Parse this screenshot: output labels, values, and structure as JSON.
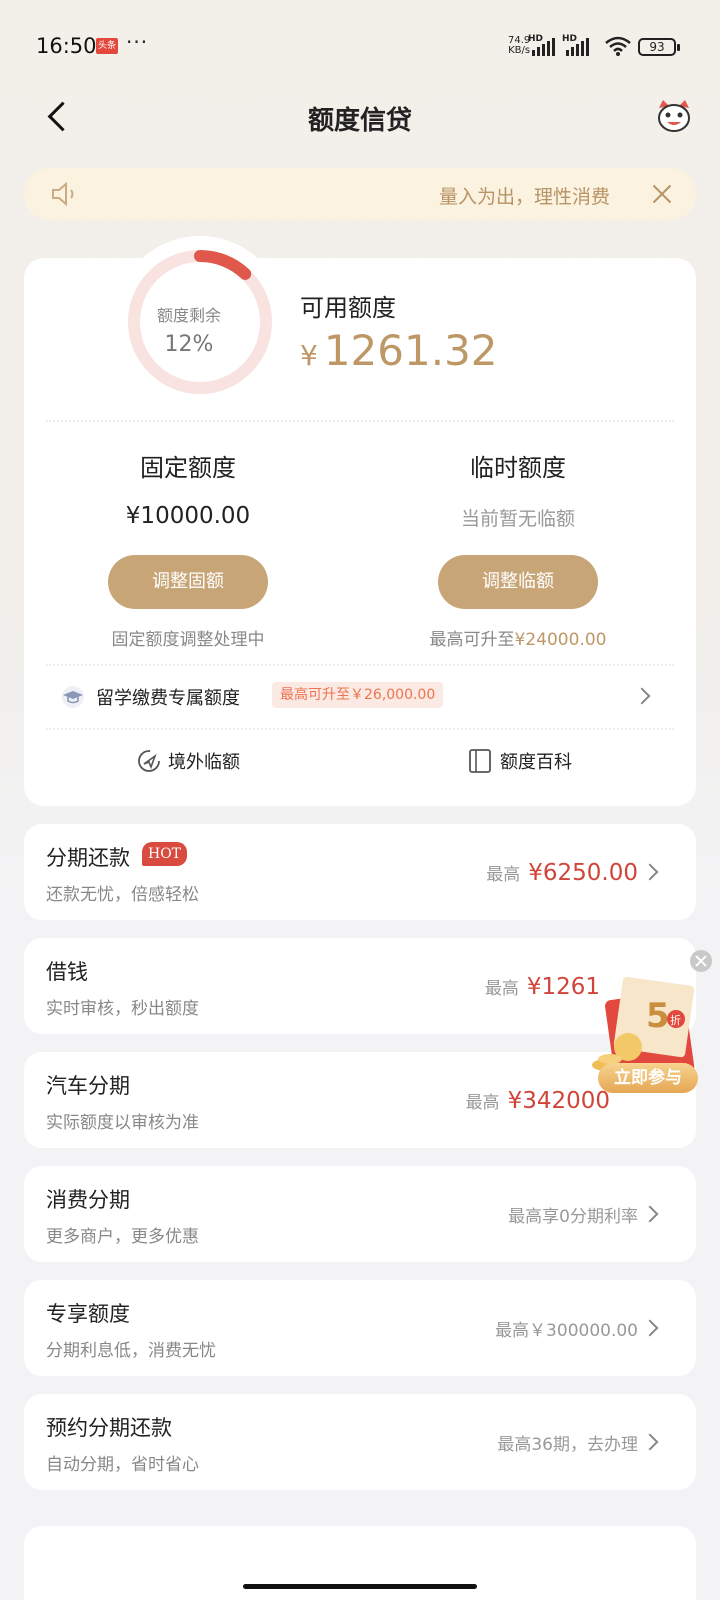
{
  "status_bar": {
    "time": "16:50",
    "news_badge": "头条",
    "more": "···",
    "net_speed": "74.9",
    "net_unit": "KB/s",
    "hd1": "HD",
    "hd2": "HD",
    "battery": "93"
  },
  "nav": {
    "title": "额度信贷",
    "back_icon": "chevron-left-icon",
    "mascot_icon": "mascot-icon"
  },
  "notice": {
    "text": "量入为出，理性消费",
    "icon": "speaker-icon"
  },
  "quota": {
    "ring_label": "额度剩余",
    "ring_percent": "12%",
    "ring_fraction": 0.12,
    "available_label": "可用额度",
    "available_currency": "¥",
    "available_amount": "1261.32",
    "fixed": {
      "title": "固定额度",
      "amount": "¥10000.00",
      "button": "调整固额",
      "note": "固定额度调整处理中"
    },
    "temporary": {
      "title": "临时额度",
      "status": "当前暂无临额",
      "button": "调整临额",
      "note_prefix": "最高可升至",
      "note_value": "¥24000.00"
    },
    "study": {
      "label": "留学缴费专属额度",
      "tag": "最高可升至￥26,000.00"
    },
    "links": {
      "overseas": "境外临额",
      "encyclopedia": "额度百科"
    }
  },
  "services": [
    {
      "title": "分期还款",
      "badge": "HOT",
      "subtitle": "还款无忧，倍感轻松",
      "prefix": "最高",
      "value": "¥6250.00"
    },
    {
      "title": "借钱",
      "subtitle": "实时审核，秒出额度",
      "prefix": "最高",
      "value": "¥1261"
    },
    {
      "title": "汽车分期",
      "subtitle": "实际额度以审核为准",
      "prefix": "最高",
      "value": "¥342000"
    },
    {
      "title": "消费分期",
      "subtitle": "更多商户，更多优惠",
      "right_text": "最高享0分期利率"
    },
    {
      "title": "专享额度",
      "subtitle": "分期利息低，消费无忧",
      "right_text": "最高￥300000.00"
    },
    {
      "title": "预约分期还款",
      "subtitle": "自动分期，省时省心",
      "right_text": "最高36期，去办理"
    }
  ],
  "promo": {
    "big": "5",
    "small": "折",
    "button": "立即参与"
  },
  "colors": {
    "accent_gold": "#c8a577",
    "money_red": "#d0453a",
    "ring_red": "#e0574c"
  }
}
